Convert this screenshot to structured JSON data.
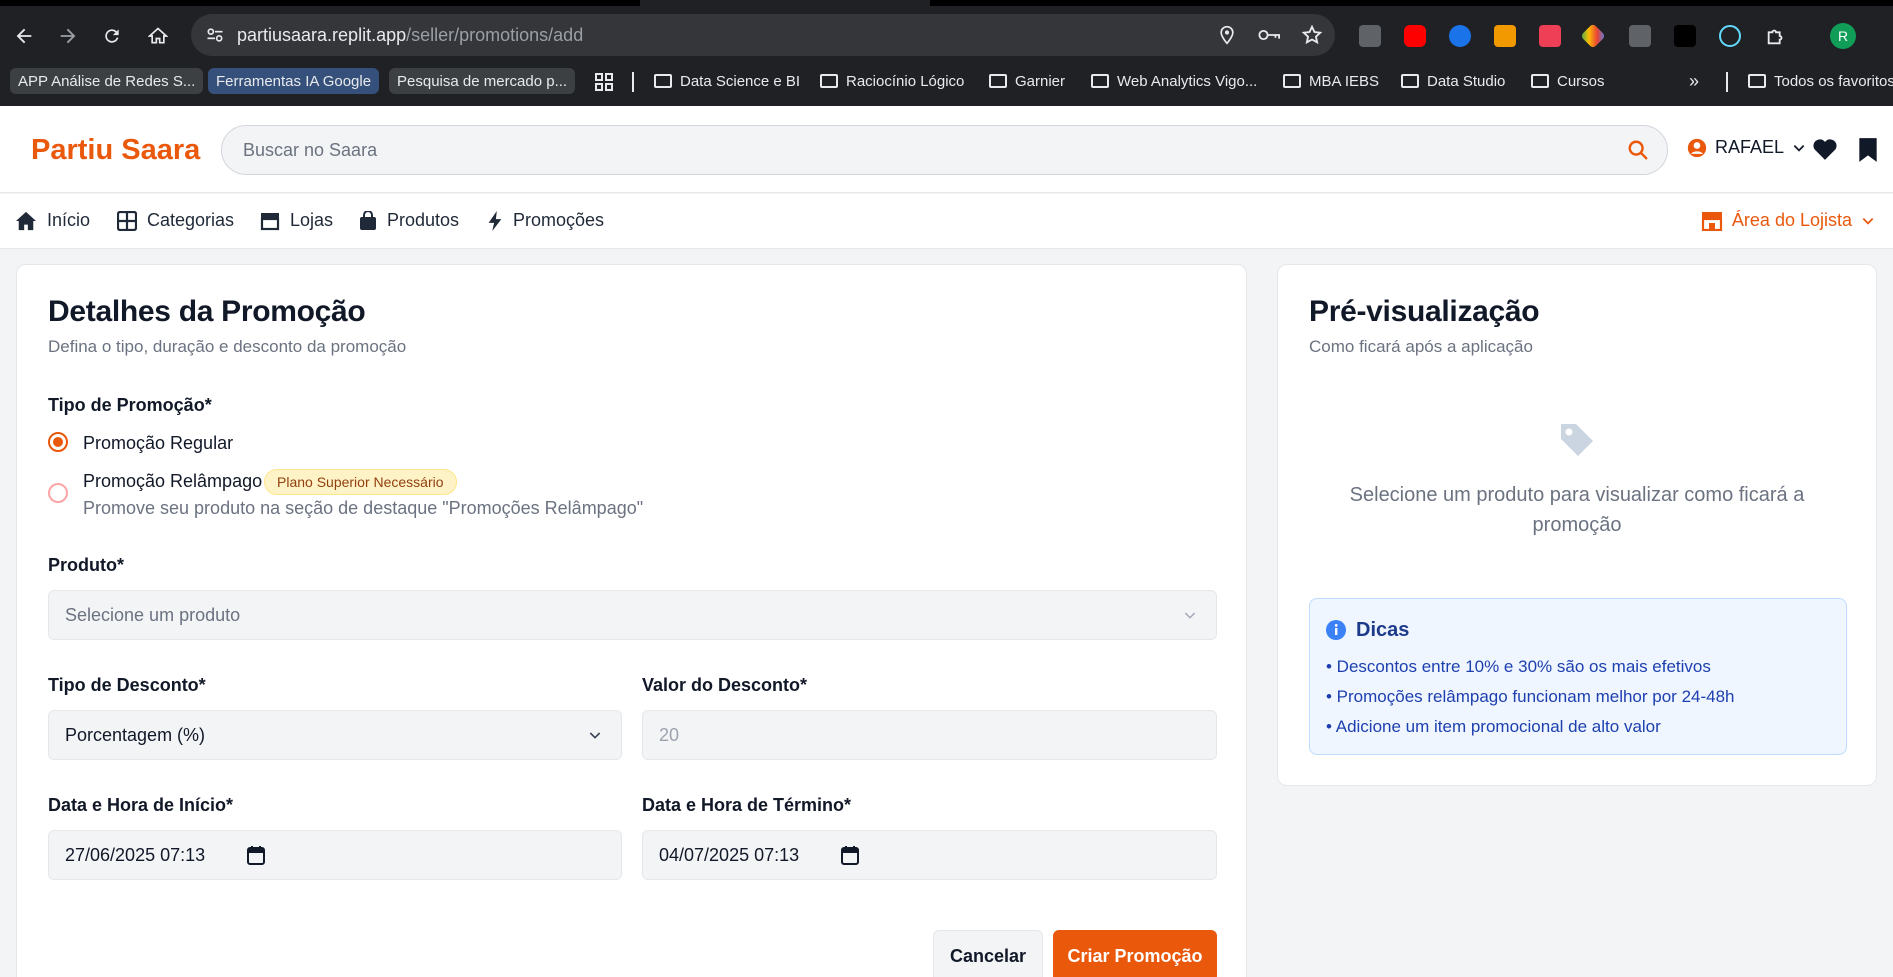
{
  "browser": {
    "url_host": "partiusaara.replit.app",
    "url_path": "/seller/promotions/add",
    "bookmarks": [
      {
        "label": "APP Análise de Redes S...",
        "kind": "chip"
      },
      {
        "label": "Ferramentas IA Google",
        "kind": "chip-blue"
      },
      {
        "label": "Pesquisa de mercado p...",
        "kind": "chip"
      },
      {
        "label": "Data Science e BI",
        "kind": "folder"
      },
      {
        "label": "Raciocínio Lógico",
        "kind": "folder"
      },
      {
        "label": "Garnier",
        "kind": "folder"
      },
      {
        "label": "Web Analytics Vigo...",
        "kind": "folder"
      },
      {
        "label": "MBA IEBS",
        "kind": "folder"
      },
      {
        "label": "Data Studio",
        "kind": "folder"
      },
      {
        "label": "Cursos",
        "kind": "folder"
      },
      {
        "label": "Todos os favoritos",
        "kind": "folder"
      }
    ],
    "overflow_label": "»",
    "profile_initial": "R"
  },
  "header": {
    "logo": "Partiu Saara",
    "search_placeholder": "Buscar no Saara",
    "user_name": "RAFAEL"
  },
  "nav": {
    "items": [
      "Início",
      "Categorias",
      "Lojas",
      "Produtos",
      "Promoções"
    ],
    "seller_area": "Área do Lojista"
  },
  "form": {
    "title": "Detalhes da Promoção",
    "subtitle": "Defina o tipo, duração e desconto da promoção",
    "promo_type_label": "Tipo de Promoção*",
    "option_regular": "Promoção Regular",
    "option_flash": "Promoção Relâmpago",
    "flash_badge": "Plano Superior Necessário",
    "flash_description": "Promove seu produto na seção de destaque \"Promoções Relâmpago\"",
    "selected_option": "Promoção Regular",
    "product_label": "Produto*",
    "product_placeholder": "Selecione um produto",
    "discount_type_label": "Tipo de Desconto*",
    "discount_type_value": "Porcentagem (%)",
    "discount_value_label": "Valor do Desconto*",
    "discount_value": "20",
    "start_label": "Data e Hora de Início*",
    "start_value": "27/06/2025 07:13",
    "end_label": "Data e Hora de Término*",
    "end_value": "04/07/2025 07:13",
    "cancel_label": "Cancelar",
    "create_label": "Criar Promoção"
  },
  "preview": {
    "title": "Pré-visualização",
    "subtitle": "Como ficará após a aplicação",
    "empty_line1": "Selecione um produto para visualizar como ficará a",
    "empty_line2": "promoção",
    "tips_title": "Dicas",
    "tips": [
      "• Descontos entre 10% e 30% são os mais efetivos",
      "• Promoções relâmpago funcionam melhor por 24-48h",
      "• Adicione um item promocional de alto valor"
    ]
  },
  "colors": {
    "brand": "#ea580c",
    "tips_bg": "#eff6ff",
    "tips_text": "#1e40af"
  }
}
